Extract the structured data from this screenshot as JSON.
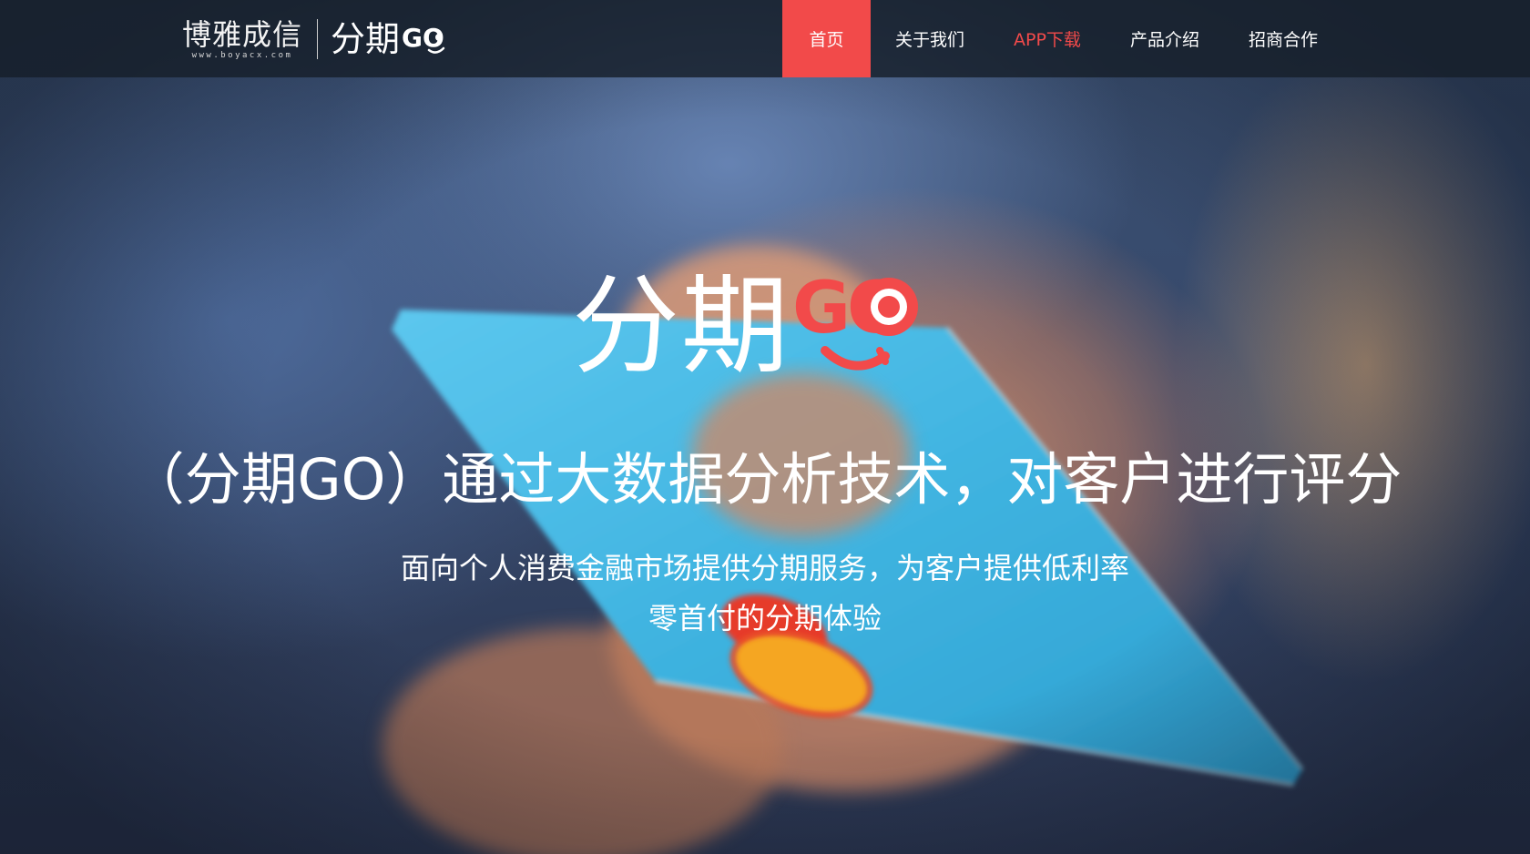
{
  "brand": {
    "company_name": "博雅成信",
    "company_url": "www.boyacx.com",
    "product_name": "分期",
    "product_suffix": "GO"
  },
  "nav": {
    "items": [
      {
        "label": "首页"
      },
      {
        "label": "关于我们"
      },
      {
        "label": "APP下载"
      },
      {
        "label": "产品介绍"
      },
      {
        "label": "招商合作"
      }
    ]
  },
  "hero": {
    "logo_text": "分期",
    "logo_suffix": "GO",
    "headline": "（分期GO）通过大数据分析技术，对客户进行评分",
    "subline_1": "面向个人消费金融市场提供分期服务，为客户提供低利率",
    "subline_2": "零首付的分期体验"
  },
  "colors": {
    "accent_red": "#f24a4a",
    "nav_bg": "#161e2a",
    "card_blue": "#3fb3e0"
  },
  "icons": {
    "brand_go": "go-smile-logo-icon",
    "hero_go": "go-smile-logo-icon"
  }
}
